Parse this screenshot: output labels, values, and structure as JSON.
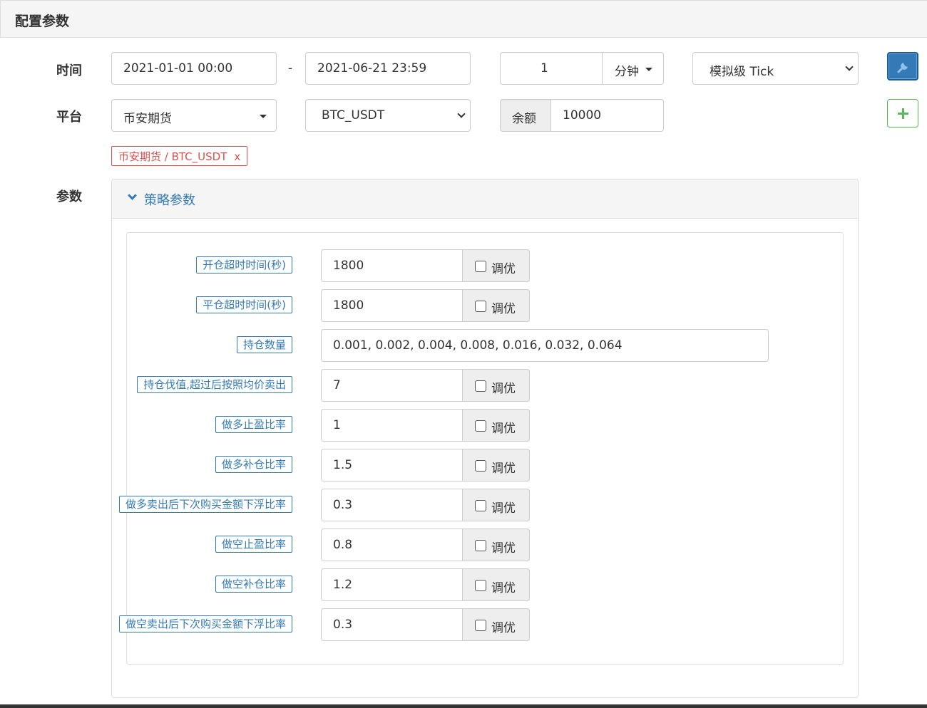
{
  "header": {
    "title": "配置参数"
  },
  "labels": {
    "time": "时间",
    "platform": "平台",
    "params": "参数"
  },
  "time": {
    "start": "2021-01-01 00:00",
    "separator": "-",
    "end": "2021-06-21 23:59",
    "period_value": "1",
    "period_unit": "分钟",
    "mode": "模拟级 Tick"
  },
  "platform": {
    "exchange": "币安期货",
    "pair": "BTC_USDT",
    "balance_label": "余额",
    "balance_value": "10000"
  },
  "tag": {
    "text": "币安期货 / BTC_USDT",
    "close": "x"
  },
  "strategy": {
    "title": "策略参数",
    "tune_label": "调优",
    "params": [
      {
        "label": "开仓超时时间(秒)",
        "value": "1800",
        "tunable": true
      },
      {
        "label": "平仓超时时间(秒)",
        "value": "1800",
        "tunable": true
      },
      {
        "label": "持仓数量",
        "value": "0.001, 0.002, 0.004, 0.008, 0.016, 0.032, 0.064",
        "tunable": false
      },
      {
        "label": "持仓伐值,超过后按照均价卖出",
        "value": "7",
        "tunable": true
      },
      {
        "label": "做多止盈比率",
        "value": "1",
        "tunable": true
      },
      {
        "label": "做多补仓比率",
        "value": "1.5",
        "tunable": true
      },
      {
        "label": "做多卖出后下次购买金额下浮比率",
        "value": "0.3",
        "tunable": true
      },
      {
        "label": "做空止盈比率",
        "value": "0.8",
        "tunable": true
      },
      {
        "label": "做空补仓比率",
        "value": "1.2",
        "tunable": true
      },
      {
        "label": "做空卖出后下次购买金额下浮比率",
        "value": "0.3",
        "tunable": true
      }
    ]
  },
  "colors": {
    "accent": "#337ab7",
    "danger": "#d9534f",
    "success": "#5cb85c"
  },
  "icons": {
    "tool_button": "wrench-icon",
    "add_button": "plus-icon"
  }
}
